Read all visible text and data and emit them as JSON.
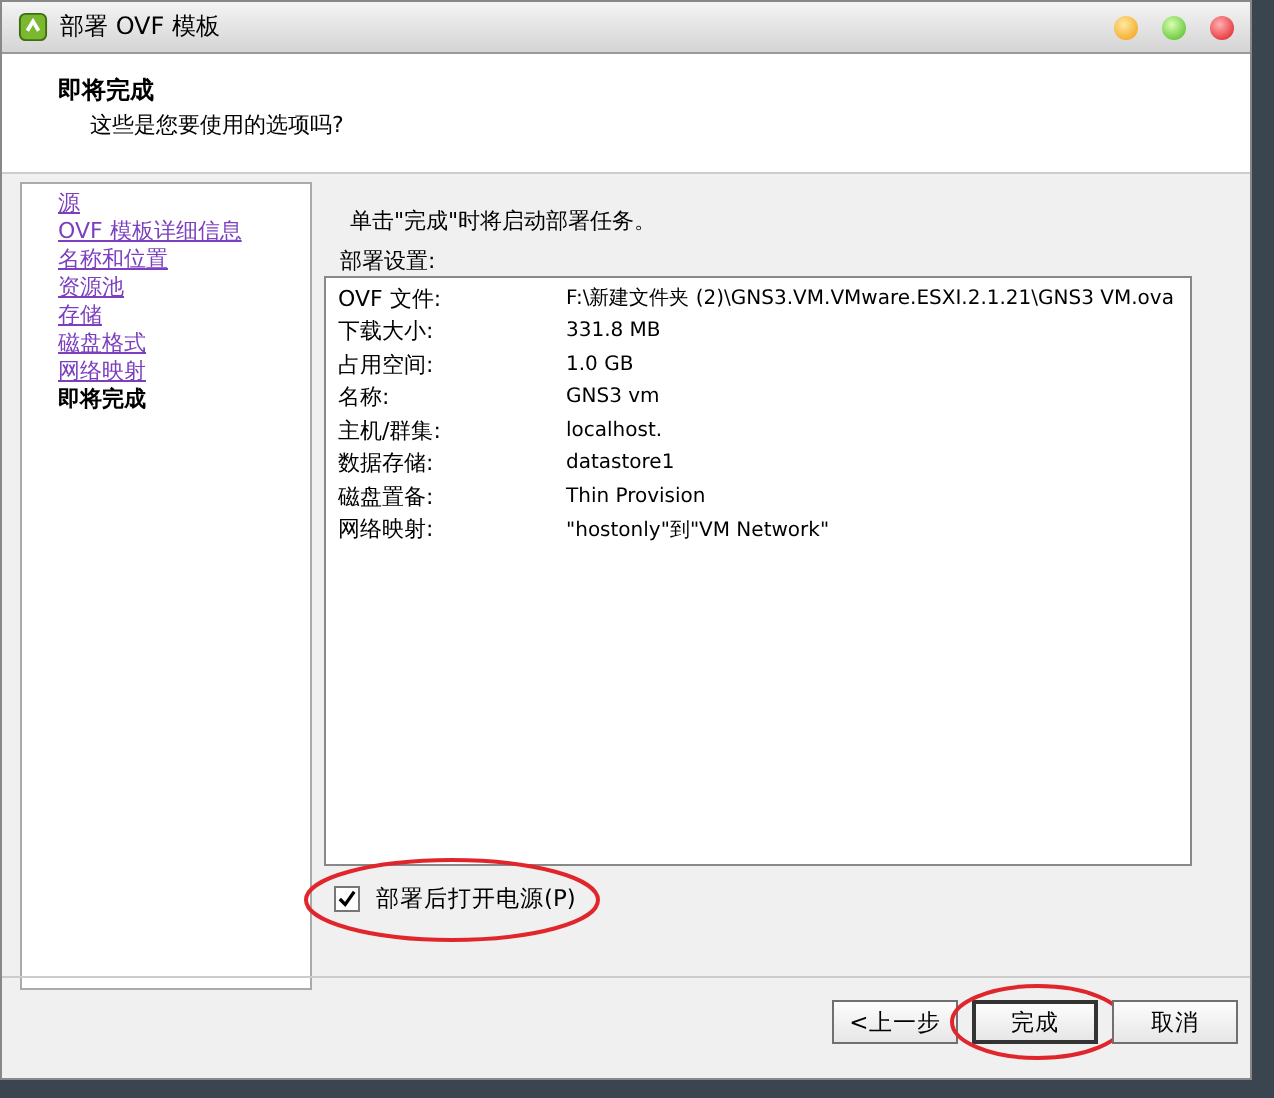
{
  "window": {
    "title": "部署 OVF 模板"
  },
  "header": {
    "title": "即将完成",
    "subtitle": "这些是您要使用的选项吗?"
  },
  "steps": [
    {
      "label": "源",
      "selected": false
    },
    {
      "label": "OVF 模板详细信息",
      "selected": false
    },
    {
      "label": "名称和位置",
      "selected": false
    },
    {
      "label": "资源池",
      "selected": false
    },
    {
      "label": "存储",
      "selected": false
    },
    {
      "label": "磁盘格式",
      "selected": false
    },
    {
      "label": "网络映射",
      "selected": false
    },
    {
      "label": "即将完成",
      "selected": true
    }
  ],
  "intro": "单击\"完成\"时将启动部署任务。",
  "settings": {
    "label": "部署设置:",
    "rows": [
      {
        "key": "OVF 文件:",
        "value": "F:\\新建文件夹 (2)\\GNS3.VM.VMware.ESXI.2.1.21\\GNS3 VM.ova"
      },
      {
        "key": "下载大小:",
        "value": "331.8 MB"
      },
      {
        "key": "占用空间:",
        "value": "1.0 GB"
      },
      {
        "key": "名称:",
        "value": "GNS3 vm"
      },
      {
        "key": "主机/群集:",
        "value": "localhost."
      },
      {
        "key": "数据存储:",
        "value": "datastore1"
      },
      {
        "key": "磁盘置备:",
        "value": "Thin Provision"
      },
      {
        "key": "网络映射:",
        "value": "\"hostonly\"到\"VM Network\""
      }
    ]
  },
  "power_on": {
    "label": "部署后打开电源(P)",
    "checked": true
  },
  "buttons": [
    {
      "label": "<上一步",
      "kind": "back"
    },
    {
      "label": "完成",
      "kind": "finish"
    },
    {
      "label": "取消",
      "kind": "cancel"
    }
  ]
}
